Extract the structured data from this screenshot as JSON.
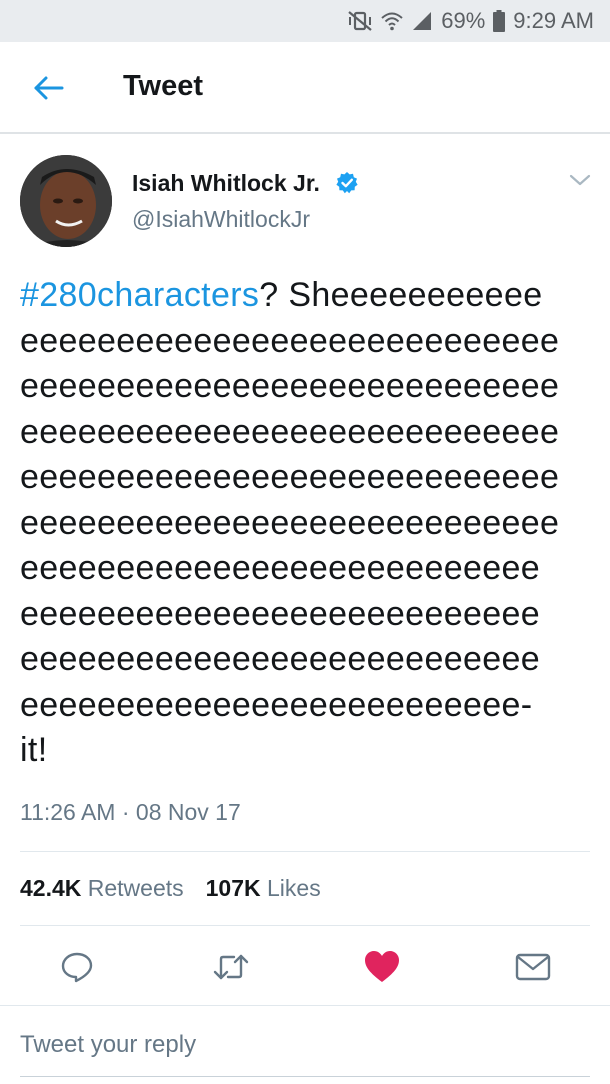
{
  "status_bar": {
    "battery": "69%",
    "time": "9:29 AM"
  },
  "header": {
    "title": "Tweet"
  },
  "tweet": {
    "author_name": "Isiah Whitlock Jr.",
    "author_handle": "@IsiahWhitlockJr",
    "hashtag": "#280characters",
    "text_after_hashtag": "? Sheeeeeeeeeee",
    "lines": [
      "eeeeeeeeeeeeeeeeeeeeeeeeeeee",
      "eeeeeeeeeeeeeeeeeeeeeeeeeeee",
      "eeeeeeeeeeeeeeeeeeeeeeeeeeee",
      "eeeeeeeeeeeeeeeeeeeeeeeeeeee",
      "eeeeeeeeeeeeeeeeeeeeeeeeeeee",
      "eeeeeeeeeeeeeeeeeeeeeeeeeee",
      "eeeeeeeeeeeeeeeeeeeeeeeeeee",
      "eeeeeeeeeeeeeeeeeeeeeeeeeee",
      "eeeeeeeeeeeeeeeeeeeeeeeeee-",
      "it!"
    ],
    "timestamp": "11:26 AM · 08 Nov 17",
    "retweets_count": "42.4K",
    "retweets_label": "Retweets",
    "likes_count": "107K",
    "likes_label": "Likes",
    "liked": true
  },
  "reply": {
    "placeholder": "Tweet your reply"
  },
  "colors": {
    "link": "#1b95e0",
    "like": "#e0245e",
    "muted": "#657786"
  }
}
